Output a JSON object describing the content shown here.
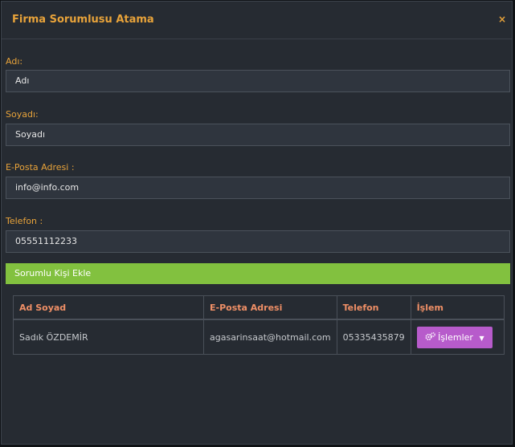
{
  "modal": {
    "title": "Firma Sorumlusu Atama",
    "close_label": "×"
  },
  "form": {
    "name_label": "Adı:",
    "name_value": "Adı",
    "surname_label": "Soyadı:",
    "surname_value": "Soyadı",
    "email_label": "E-Posta Adresi :",
    "email_value": "info@info.com",
    "phone_label": "Telefon :",
    "phone_value": "05551112233",
    "submit_label": "Sorumlu Kişi Ekle"
  },
  "table": {
    "headers": [
      "Ad Soyad",
      "E-Posta Adresi",
      "Telefon",
      "İşlem"
    ],
    "rows": [
      {
        "name": "Sadık ÖZDEMİR",
        "email": "agasarinsaat@hotmail.com",
        "phone": "05335435879",
        "action_label": "İşlemler",
        "action_icon": "cogs-icon"
      }
    ]
  },
  "colors": {
    "accent": "#e8a33a",
    "header_text": "#ef8f66",
    "submit_bg": "#82c13f",
    "action_bg": "#b75bcb",
    "panel_bg": "#262b32"
  }
}
